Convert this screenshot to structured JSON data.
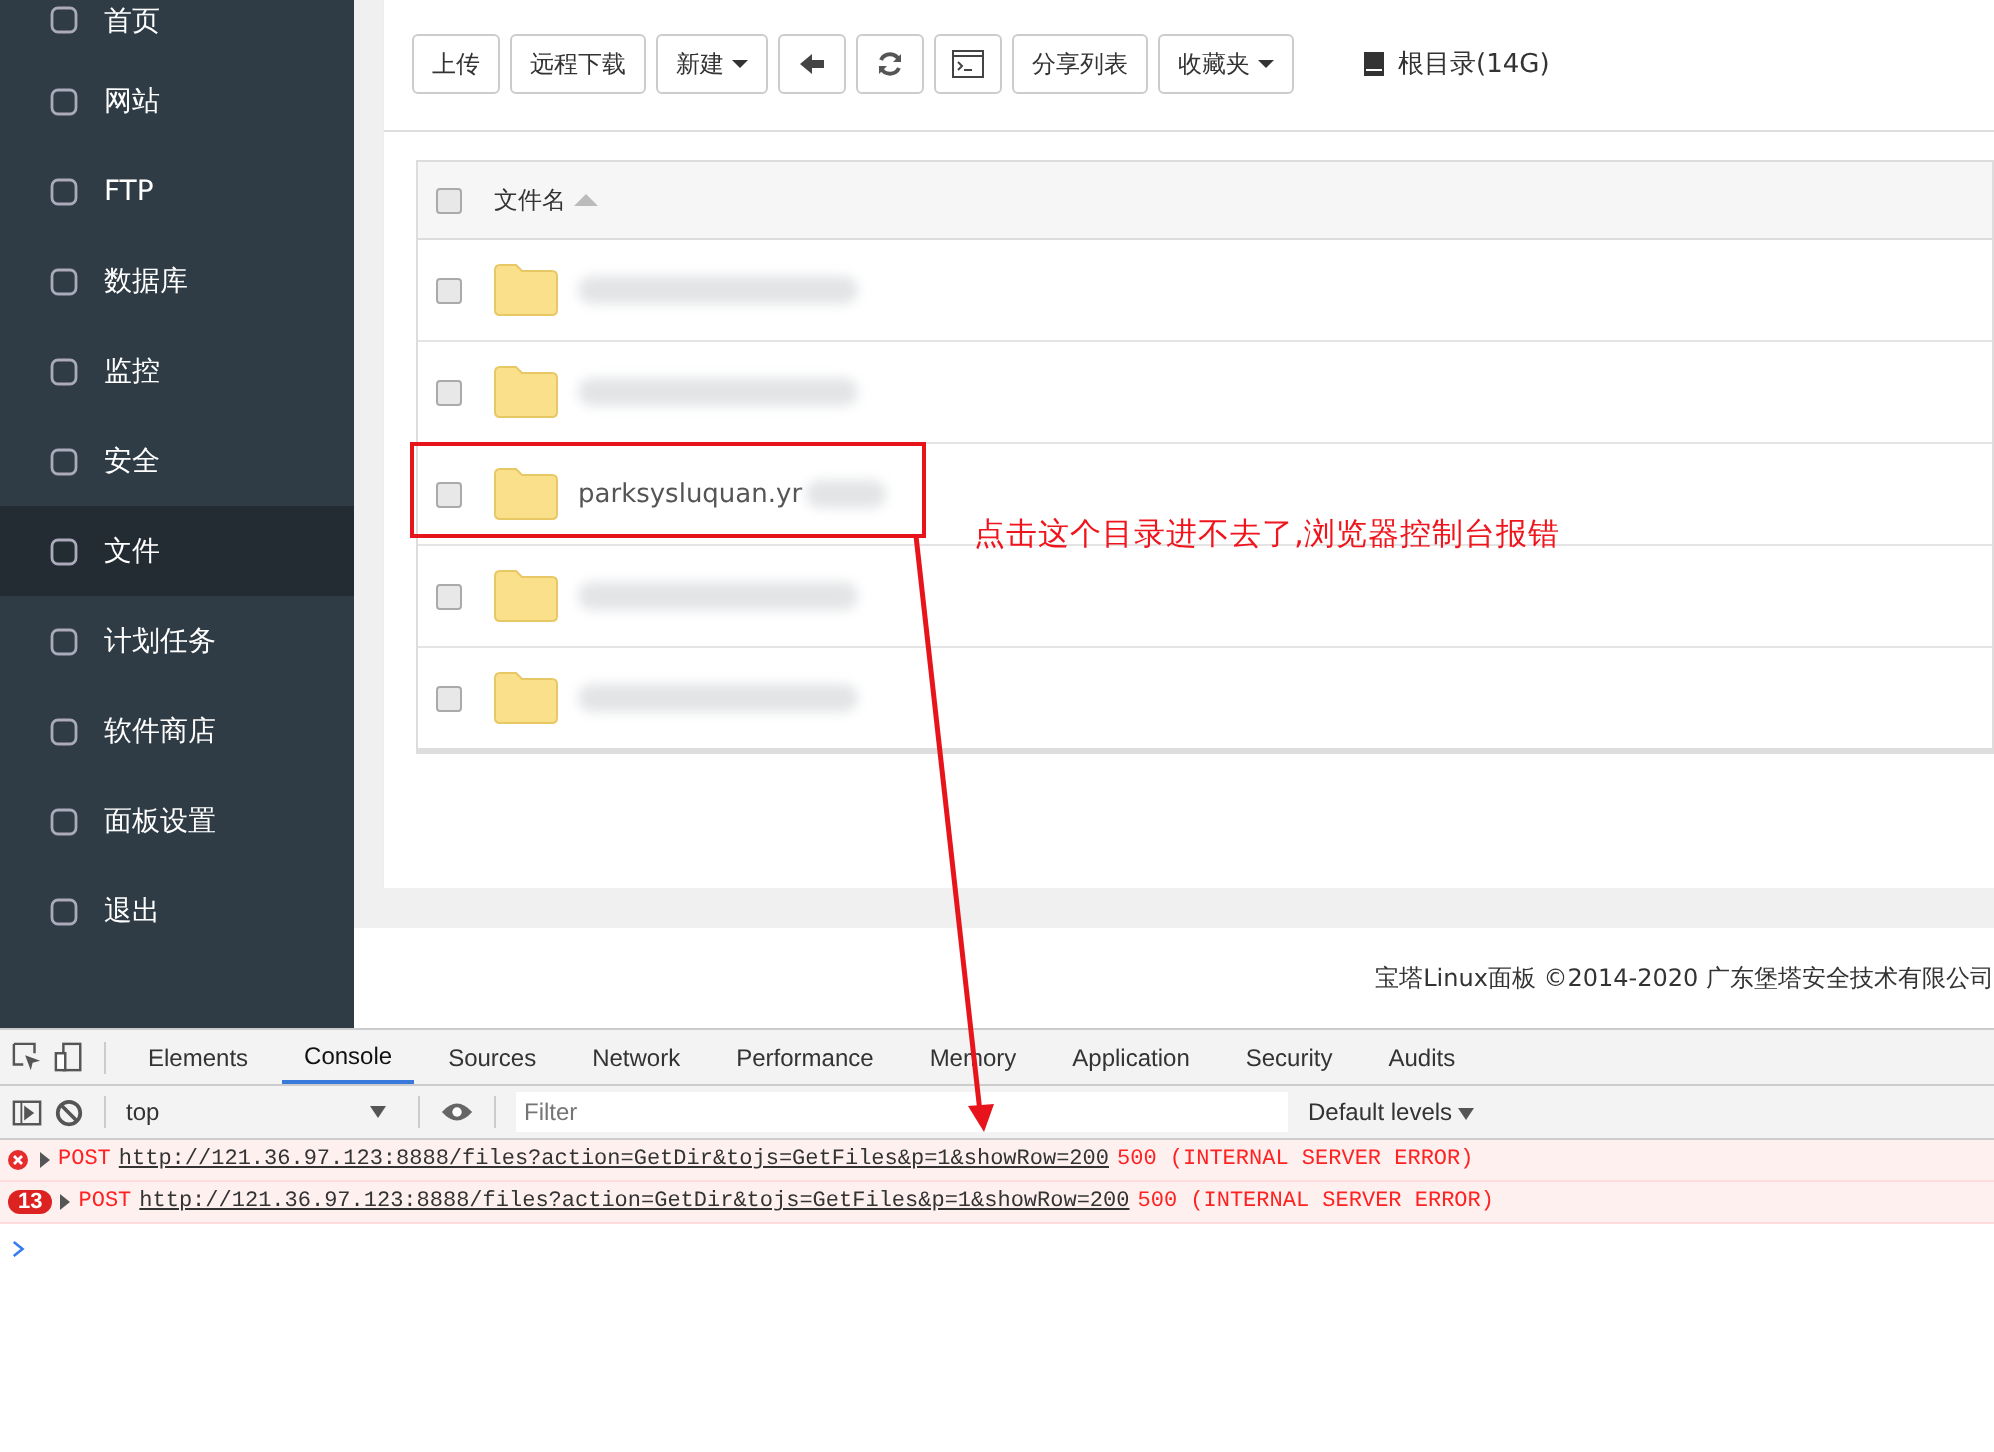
{
  "sidebar": {
    "items": [
      {
        "label": "首页",
        "selected": false
      },
      {
        "label": "网站",
        "selected": false
      },
      {
        "label": "FTP",
        "selected": false
      },
      {
        "label": "数据库",
        "selected": false
      },
      {
        "label": "监控",
        "selected": false
      },
      {
        "label": "安全",
        "selected": false
      },
      {
        "label": "文件",
        "selected": true
      },
      {
        "label": "计划任务",
        "selected": false
      },
      {
        "label": "软件商店",
        "selected": false
      },
      {
        "label": "面板设置",
        "selected": false
      },
      {
        "label": "退出",
        "selected": false
      }
    ]
  },
  "toolbar": {
    "buttons": [
      {
        "kind": "text",
        "label": "上传",
        "caret": false
      },
      {
        "kind": "text",
        "label": "远程下载",
        "caret": false
      },
      {
        "kind": "text",
        "label": "新建",
        "caret": true
      },
      {
        "kind": "back"
      },
      {
        "kind": "refresh"
      },
      {
        "kind": "terminal"
      },
      {
        "kind": "text",
        "label": "分享列表",
        "caret": false
      },
      {
        "kind": "text",
        "label": "收藏夹",
        "caret": true
      }
    ],
    "path": "根目录(14G)"
  },
  "table": {
    "columns": [
      "文件名"
    ],
    "select_all_checked": false,
    "rows": [
      {
        "name": "",
        "redacted": true,
        "checked": false
      },
      {
        "name": "",
        "redacted": true,
        "checked": false
      },
      {
        "name": "parksysluquan.yr",
        "redacted": true,
        "checked": false,
        "highlighted": true
      },
      {
        "name": "",
        "redacted": true,
        "checked": false
      },
      {
        "name": "",
        "redacted": true,
        "checked": false
      }
    ]
  },
  "annotation": "点击这个目录进不去了,浏览器控制台报错",
  "footer": "宝塔Linux面板 ©2014-2020 广东堡塔安全技术有限公司",
  "devtools": {
    "tabs": [
      {
        "label": "Elements",
        "selected": false
      },
      {
        "label": "Console",
        "selected": true
      },
      {
        "label": "Sources",
        "selected": false
      },
      {
        "label": "Network",
        "selected": false
      },
      {
        "label": "Performance",
        "selected": false
      },
      {
        "label": "Memory",
        "selected": false
      },
      {
        "label": "Application",
        "selected": false
      },
      {
        "label": "Security",
        "selected": false
      },
      {
        "label": "Audits",
        "selected": false
      }
    ],
    "context": "top",
    "filter_placeholder": "Filter",
    "levels": "Default levels",
    "messages": [
      {
        "method": "POST",
        "url": "http://121.36.97.123:8888/files?action=GetDir&tojs=GetFiles&p=1&showRow=200",
        "status": "500 (INTERNAL SERVER ERROR)"
      },
      {
        "count": "13",
        "method": "POST",
        "url": "http://121.36.97.123:8888/files?action=GetDir&tojs=GetFiles&p=1&showRow=200",
        "status": "500 (INTERNAL SERVER ERROR)"
      }
    ]
  }
}
